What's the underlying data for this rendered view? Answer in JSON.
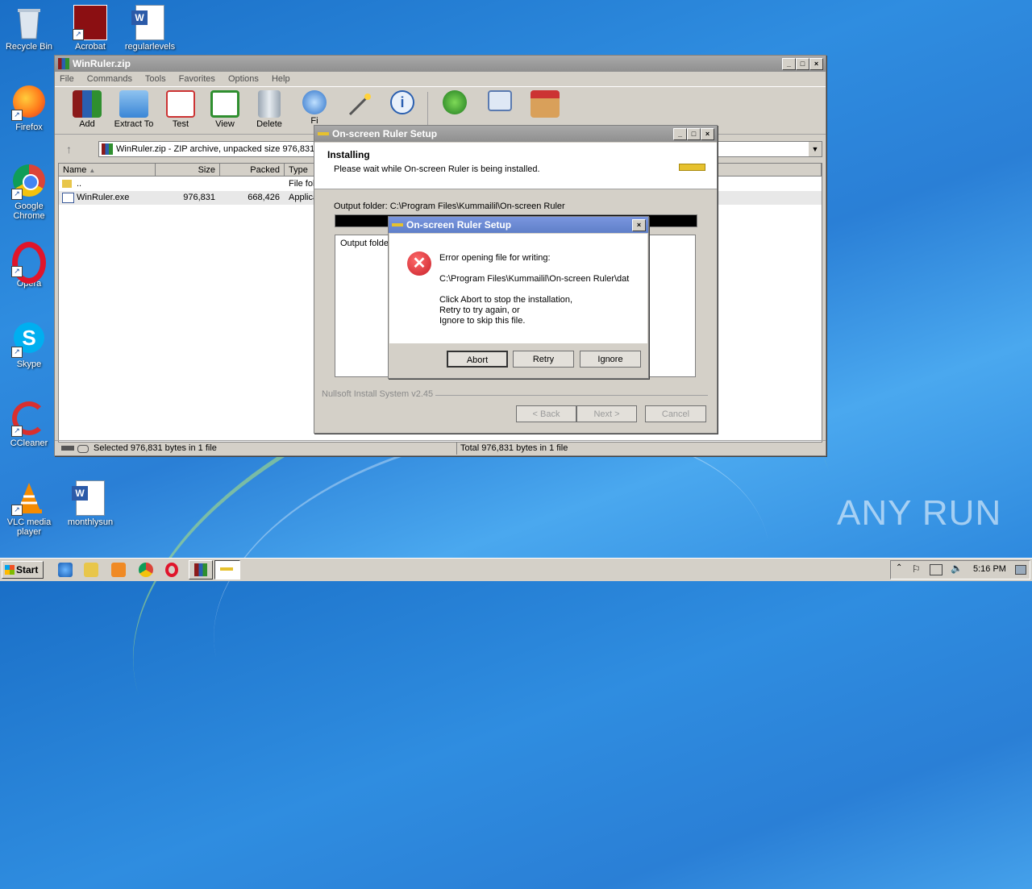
{
  "desktop": {
    "icons": [
      {
        "label": "Recycle Bin"
      },
      {
        "label": "Acrobat"
      },
      {
        "label": "regularlevels"
      },
      {
        "label": "Firefox"
      },
      {
        "label": "Google Chrome"
      },
      {
        "label": "Opera"
      },
      {
        "label": "Skype"
      },
      {
        "label": "CCleaner"
      },
      {
        "label": "VLC media player"
      },
      {
        "label": "monthlysun"
      }
    ],
    "watermark": "ANY RUN"
  },
  "winrar": {
    "title": "WinRuler.zip",
    "menu": [
      "File",
      "Commands",
      "Tools",
      "Favorites",
      "Options",
      "Help"
    ],
    "tools": [
      "Add",
      "Extract To",
      "Test",
      "View",
      "Delete",
      "Fi"
    ],
    "address": "WinRuler.zip - ZIP archive, unpacked size 976,831",
    "columns": [
      "Name",
      "Size",
      "Packed",
      "Type"
    ],
    "rows": [
      {
        "name": "..",
        "size": "",
        "packed": "",
        "type": "File fol"
      },
      {
        "name": "WinRuler.exe",
        "size": "976,831",
        "packed": "668,426",
        "type": "Applica"
      }
    ],
    "status_left": "Selected 976,831 bytes in 1 file",
    "status_right": "Total 976,831 bytes in 1 file"
  },
  "setup": {
    "title": "On-screen Ruler Setup",
    "heading": "Installing",
    "subheading": "Please wait while On-screen Ruler is being installed.",
    "output_folder": "Output folder: C:\\Program Files\\Kummailil\\On-screen Ruler",
    "log_line": "Output folde",
    "branding": "Nullsoft Install System v2.45",
    "back": "< Back",
    "next": "Next >",
    "cancel": "Cancel"
  },
  "error": {
    "title": "On-screen Ruler Setup",
    "line1": "Error opening file for writing:",
    "line2": "C:\\Program Files\\Kummailil\\On-screen Ruler\\dat",
    "line3": "Click Abort to stop the installation,",
    "line4": "Retry to try again, or",
    "line5": "Ignore to skip this file.",
    "abort": "Abort",
    "retry": "Retry",
    "ignore": "Ignore"
  },
  "taskbar": {
    "start": "Start",
    "clock": "5:16 PM"
  },
  "colors": {
    "title_active": "#5f7fc8",
    "desktop": "#2a7fd6",
    "error_red": "#c8202a"
  }
}
